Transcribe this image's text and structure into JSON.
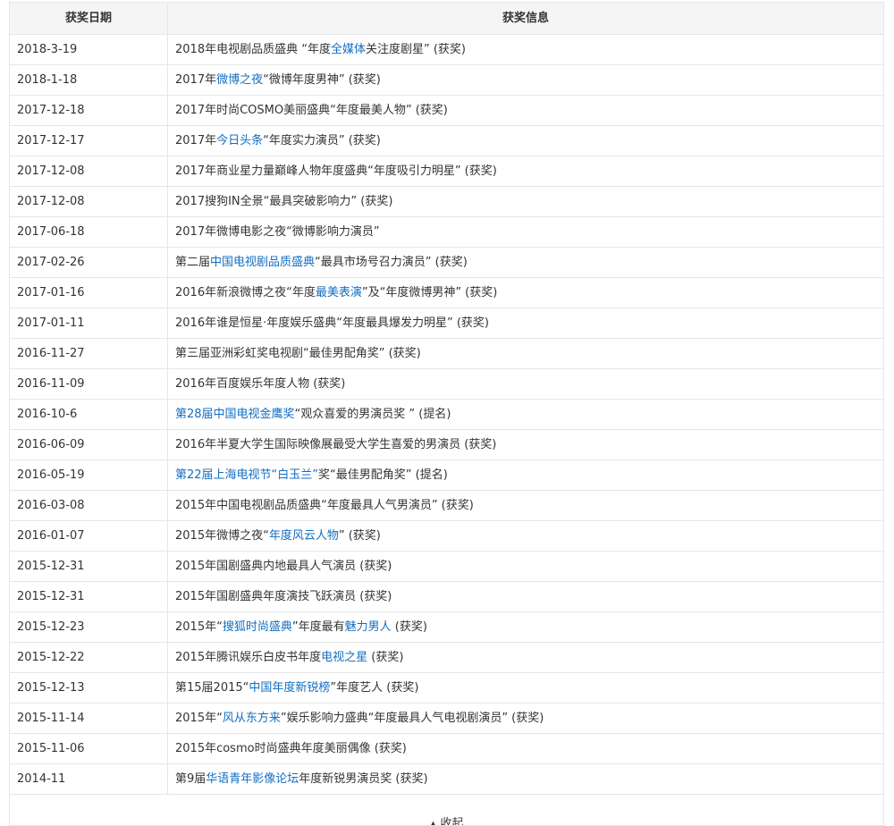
{
  "table": {
    "headers": {
      "date": "获奖日期",
      "info": "获奖信息"
    },
    "rows": [
      {
        "date": "2018-3-19",
        "info": [
          {
            "text": "2018年电视剧品质盛典 “年度",
            "link": false
          },
          {
            "text": "全媒体",
            "link": true
          },
          {
            "text": "关注度剧星” (获奖)",
            "link": false
          }
        ]
      },
      {
        "date": "2018-1-18",
        "info": [
          {
            "text": "2017年",
            "link": false
          },
          {
            "text": "微博之夜",
            "link": true
          },
          {
            "text": "“微博年度男神” (获奖)",
            "link": false
          }
        ]
      },
      {
        "date": "2017-12-18",
        "info": [
          {
            "text": "2017年时尚COSMO美丽盛典“年度最美人物” (获奖)",
            "link": false
          }
        ]
      },
      {
        "date": "2017-12-17",
        "info": [
          {
            "text": "2017年",
            "link": false
          },
          {
            "text": "今日头条",
            "link": true
          },
          {
            "text": "“年度实力演员” (获奖)",
            "link": false
          }
        ]
      },
      {
        "date": "2017-12-08",
        "info": [
          {
            "text": "2017年商业星力量巅峰人物年度盛典“年度吸引力明星” (获奖)",
            "link": false
          }
        ]
      },
      {
        "date": "2017-12-08",
        "info": [
          {
            "text": " 2017搜狗IN全景“最具突破影响力” (获奖)",
            "link": false
          }
        ]
      },
      {
        "date": "2017-06-18",
        "info": [
          {
            "text": "2017年微博电影之夜“微博影响力演员”",
            "link": false
          }
        ]
      },
      {
        "date": "2017-02-26",
        "info": [
          {
            "text": "第二届",
            "link": false
          },
          {
            "text": "中国电视剧品质盛典",
            "link": true
          },
          {
            "text": "“最具市场号召力演员” (获奖)",
            "link": false
          }
        ]
      },
      {
        "date": "2017-01-16",
        "info": [
          {
            "text": "2016年新浪微博之夜“年度",
            "link": false
          },
          {
            "text": "最美表演",
            "link": true
          },
          {
            "text": "”及“年度微博男神” (获奖)",
            "link": false
          }
        ]
      },
      {
        "date": "2017-01-11",
        "info": [
          {
            "text": "2016年谁是恒星·年度娱乐盛典“年度最具爆发力明星” (获奖)",
            "link": false
          }
        ]
      },
      {
        "date": "2016-11-27",
        "info": [
          {
            "text": "第三届亚洲彩虹奖电视剧“最佳男配角奖” (获奖)",
            "link": false
          }
        ]
      },
      {
        "date": "2016-11-09",
        "info": [
          {
            "text": "2016年百度娱乐年度人物 (获奖)",
            "link": false
          }
        ]
      },
      {
        "date": "2016-10-6",
        "info": [
          {
            "text": "第28届中国电视金鹰奖",
            "link": true
          },
          {
            "text": "“观众喜爱的男演员奖 ” (提名)",
            "link": false
          }
        ]
      },
      {
        "date": "2016-06-09",
        "info": [
          {
            "text": "2016年半夏大学生国际映像展最受大学生喜爱的男演员 (获奖)",
            "link": false
          }
        ]
      },
      {
        "date": "2016-05-19",
        "info": [
          {
            "text": "第22届上海电视节“白玉兰”",
            "link": true
          },
          {
            "text": "奖“最佳男配角奖” (提名)",
            "link": false
          }
        ]
      },
      {
        "date": "2016-03-08",
        "info": [
          {
            "text": "2015年中国电视剧品质盛典“年度最具人气男演员” (获奖)",
            "link": false
          }
        ]
      },
      {
        "date": "2016-01-07",
        "info": [
          {
            "text": "2015年微博之夜“",
            "link": false
          },
          {
            "text": "年度风云人物",
            "link": true
          },
          {
            "text": "” (获奖)",
            "link": false
          }
        ]
      },
      {
        "date": "2015-12-31",
        "info": [
          {
            "text": "2015年国剧盛典内地最具人气演员 (获奖)",
            "link": false
          }
        ]
      },
      {
        "date": "2015-12-31",
        "info": [
          {
            "text": "2015年国剧盛典年度演技飞跃演员 (获奖)",
            "link": false
          }
        ]
      },
      {
        "date": "2015-12-23",
        "info": [
          {
            "text": "2015年“",
            "link": false
          },
          {
            "text": "搜狐时尚盛典",
            "link": true
          },
          {
            "text": "”年度最有",
            "link": false
          },
          {
            "text": "魅力男人",
            "link": true
          },
          {
            "text": " (获奖)",
            "link": false
          }
        ]
      },
      {
        "date": "2015-12-22",
        "info": [
          {
            "text": "2015年腾讯娱乐白皮书年度",
            "link": false
          },
          {
            "text": "电视之星",
            "link": true
          },
          {
            "text": " (获奖)",
            "link": false
          }
        ]
      },
      {
        "date": "2015-12-13",
        "info": [
          {
            "text": "第15届2015“",
            "link": false
          },
          {
            "text": "中国年度新锐榜",
            "link": true
          },
          {
            "text": "”年度艺人 (获奖)",
            "link": false
          }
        ]
      },
      {
        "date": "2015-11-14",
        "info": [
          {
            "text": "2015年“",
            "link": false
          },
          {
            "text": "风从东方来",
            "link": true
          },
          {
            "text": "”娱乐影响力盛典“年度最具人气电视剧演员” (获奖)",
            "link": false
          }
        ]
      },
      {
        "date": "2015-11-06",
        "info": [
          {
            "text": "2015年cosmo时尚盛典年度美丽偶像 (获奖)",
            "link": false
          }
        ]
      },
      {
        "date": "2014-11",
        "info": [
          {
            "text": "第9届",
            "link": false
          },
          {
            "text": "华语青年影像论坛",
            "link": true
          },
          {
            "text": "年度新锐男演员奖  (获奖)",
            "link": false
          }
        ]
      }
    ],
    "collapse_label": "收起"
  },
  "colors": {
    "link": "#136ec2",
    "text": "#333333",
    "border": "#e6e6e6",
    "header_bg": "#f5f5f5"
  }
}
